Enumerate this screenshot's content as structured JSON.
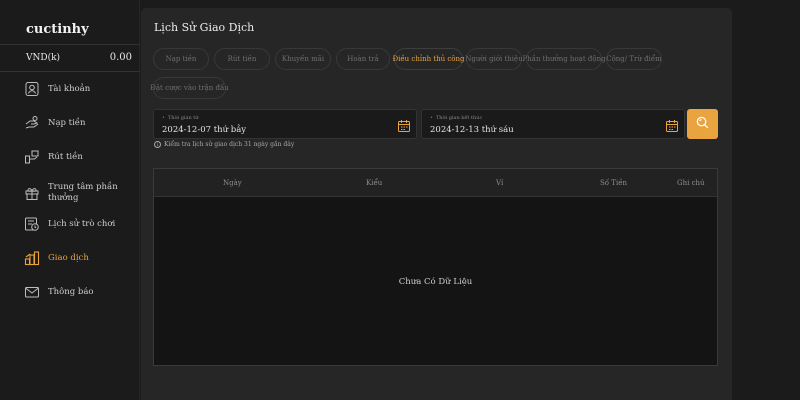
{
  "user": {
    "name": "cuctinhy",
    "currency_label": "VND(k)",
    "balance": "0.00"
  },
  "nav": [
    {
      "label": "Tài khoản",
      "icon": "account-icon",
      "active": false
    },
    {
      "label": "Nạp tiền",
      "icon": "deposit-icon",
      "active": false
    },
    {
      "label": "Rút tiền",
      "icon": "withdraw-icon",
      "active": false
    },
    {
      "label": "Trung tâm phần thưởng",
      "icon": "gift-icon",
      "active": false
    },
    {
      "label": "Lịch sử trò chơi",
      "icon": "game-history-icon",
      "active": false
    },
    {
      "label": "Giao dịch",
      "icon": "transaction-icon",
      "active": true
    },
    {
      "label": "Thông báo",
      "icon": "mail-icon",
      "active": false
    }
  ],
  "main": {
    "title": "Lịch Sử Giao Dịch",
    "tabs": [
      {
        "label": "Nạp tiền",
        "active": false
      },
      {
        "label": "Rút tiền",
        "active": false
      },
      {
        "label": "Khuyến mãi",
        "active": false
      },
      {
        "label": "Hoàn trả",
        "active": false
      },
      {
        "label": "Điều chỉnh thủ công",
        "active": true
      },
      {
        "label": "Người giới thiệu",
        "active": false
      },
      {
        "label": "Phần thưởng hoạt động",
        "active": false
      },
      {
        "label": "Cộng/ Trừ điểm",
        "active": false
      },
      {
        "label": "Đặt cược vào trận đấu",
        "active": false
      }
    ],
    "start_date": {
      "caption": "Thời gian từ",
      "value": "2024-12-07 thứ bảy"
    },
    "end_date": {
      "caption": "Thời gian kết thúc",
      "value": "2024-12-13 thứ sáu"
    },
    "hint": "Kiểm tra lịch sử giao dịch 31 ngày gần đây",
    "table": {
      "columns": [
        "Ngày",
        "Kiểu",
        "Ví",
        "Số Tiền",
        "Ghi chú"
      ],
      "empty_text": "Chưa Có Dữ Liệu"
    }
  },
  "colors": {
    "accent": "#e9a33f",
    "panel": "#262626",
    "background": "#1b1b1b"
  }
}
